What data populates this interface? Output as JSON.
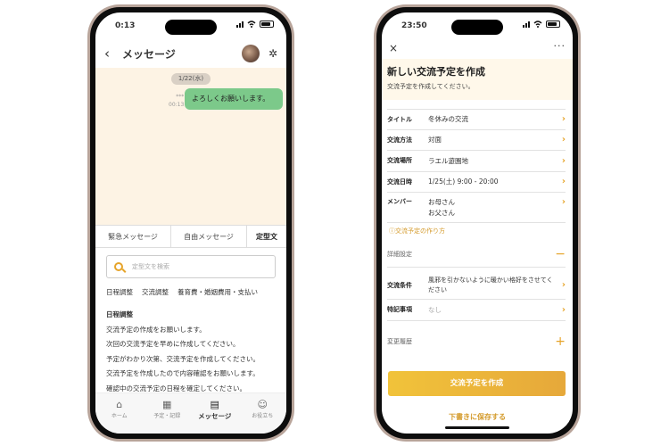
{
  "left_phone": {
    "status_time": "0:13",
    "header": {
      "back": "‹",
      "title": "メッセージ",
      "settings_icon": "gear-icon"
    },
    "chat": {
      "date": "1/22(水)",
      "message": {
        "read": "***",
        "time": "00:13",
        "text": "よろしくお願いします。"
      }
    },
    "tabs": [
      "緊急メッセージ",
      "自由メッセージ",
      "定型文"
    ],
    "search_placeholder": "定型文を検索",
    "chips": [
      "日程調整",
      "交流調整",
      "養育費・婚姻費用・支払い"
    ],
    "templates": {
      "heading": "日程調整",
      "items": [
        "交流予定の作成をお願いします。",
        "次回の交流予定を早めに作成してください。",
        "予定がわかり次第、交流予定を作成してください。",
        "交流予定を作成したので内容確認をお願いします。",
        "確認中の交流予定の日程を確定してください。"
      ]
    },
    "nav": [
      {
        "label": "ホーム",
        "icon": "home-icon"
      },
      {
        "label": "予定・記録",
        "icon": "calendar-icon"
      },
      {
        "label": "メッセージ",
        "icon": "message-icon"
      },
      {
        "label": "お役立ち",
        "icon": "helpful-icon"
      }
    ]
  },
  "right_phone": {
    "status_time": "23:50",
    "close": "×",
    "more": "···",
    "title": "新しい交流予定を作成",
    "subtitle": "交流予定を作成してください。",
    "fields": [
      {
        "label": "タイトル",
        "value": "冬休みの交流"
      },
      {
        "label": "交流方法",
        "value": "対面"
      },
      {
        "label": "交流場所",
        "value": "ラエル遊園地"
      },
      {
        "label": "交流日時",
        "value": "1/25(土) 9:00 - 20:00"
      }
    ],
    "members": {
      "label": "メンバー",
      "line1": "お母さん",
      "line2": "お父さん"
    },
    "howto_link": "ⓘ交流予定の作り方",
    "detail_section": {
      "label": "詳細設定",
      "toggle": "−"
    },
    "conditions": {
      "label": "交流条件",
      "value": "風邪を引かないように暖かい格好をさせてください"
    },
    "notes": {
      "label": "特記事項",
      "value": "なし"
    },
    "history_section": {
      "label": "変更履歴",
      "toggle": "+"
    },
    "create_button": "交流予定を作成",
    "save_draft": "下書きに保存する"
  },
  "colors": {
    "accent": "#e6a42a",
    "bubble": "#7cc98a",
    "chat_bg": "#fdf3e4",
    "form_head_bg": "#fff8ea"
  }
}
